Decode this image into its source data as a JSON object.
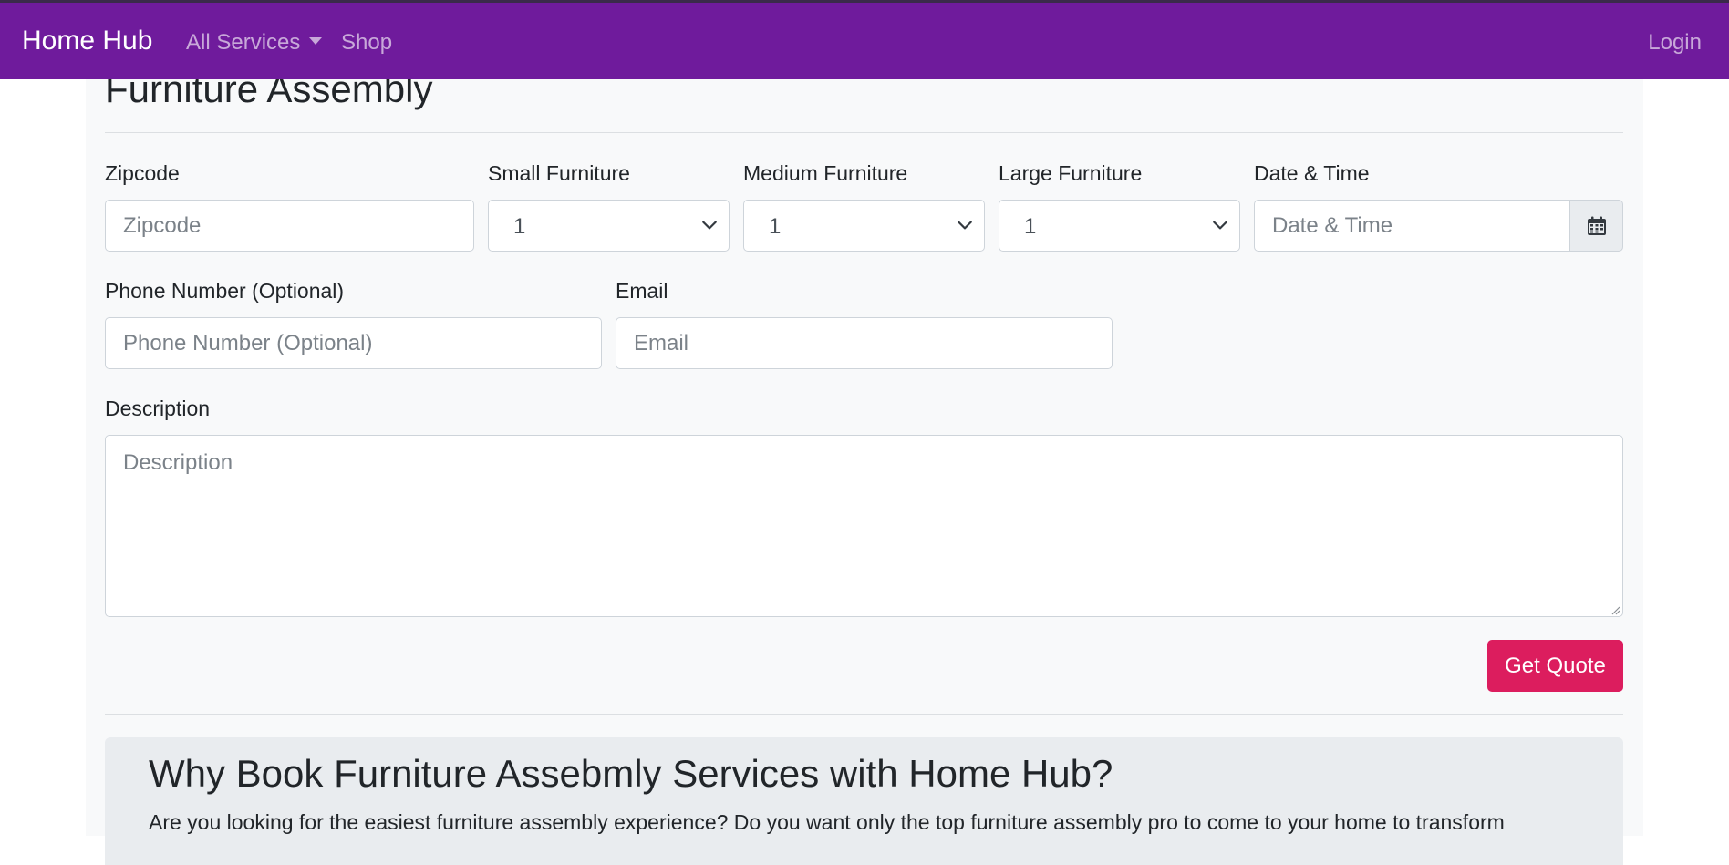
{
  "nav": {
    "brand": "Home Hub",
    "services": "All Services",
    "shop": "Shop",
    "login": "Login"
  },
  "page": {
    "title": "Furniture Assembly"
  },
  "form": {
    "zipcode": {
      "label": "Zipcode",
      "placeholder": "Zipcode",
      "value": ""
    },
    "small": {
      "label": "Small Furniture",
      "value": "1"
    },
    "medium": {
      "label": "Medium Furniture",
      "value": "1"
    },
    "large": {
      "label": "Large Furniture",
      "value": "1"
    },
    "datetime": {
      "label": "Date & Time",
      "placeholder": "Date & Time",
      "value": ""
    },
    "phone": {
      "label": "Phone Number (Optional)",
      "placeholder": "Phone Number (Optional)",
      "value": ""
    },
    "email": {
      "label": "Email",
      "placeholder": "Email",
      "value": ""
    },
    "description": {
      "label": "Description",
      "placeholder": "Description",
      "value": ""
    },
    "submit": "Get Quote"
  },
  "why": {
    "title": "Why Book Furniture Assebmly Services with Home Hub?",
    "text": "Are you looking for the easiest furniture assembly experience? Do you want only the top furniture assembly pro to come to your home to transform"
  },
  "colors": {
    "navbar": "#6f1b9c",
    "button": "#dc1d5e",
    "panel": "#f8f9fa"
  },
  "icons": {
    "calendar": "calendar-icon",
    "chevron": "chevron-down-icon"
  }
}
